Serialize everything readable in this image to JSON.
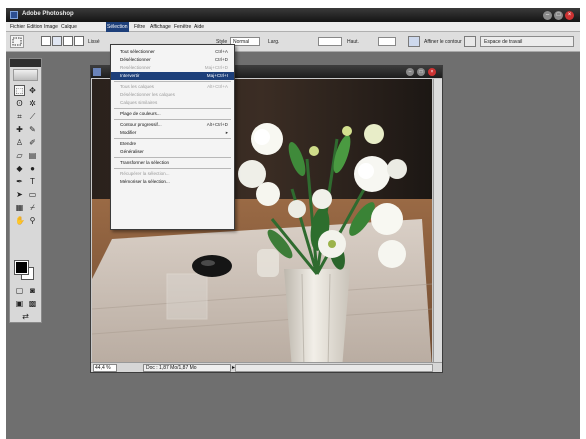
{
  "app": {
    "title": "Adobe Photoshop"
  },
  "menubar": {
    "items": [
      "Fichier",
      "Edition",
      "Image",
      "Calque",
      "Sélection",
      "Filtre",
      "Affichage",
      "Fenêtre",
      "Aide"
    ],
    "active": "Sélection"
  },
  "options": {
    "antialias_label": "Lissé",
    "style_label": "Style",
    "style_value": "Normal",
    "width_label": "Larg.",
    "height_label": "Haut.",
    "refine_label": "Affiner le contour",
    "workspace_label": "Espace de travail"
  },
  "document": {
    "zoom": "44,4 %",
    "status": "Doc : 1,87 Mo/1,87 Mo"
  },
  "selection_menu": {
    "items": [
      {
        "label": "Tout sélectionner",
        "shortcut": "Ctrl+A",
        "state": "normal"
      },
      {
        "label": "Désélectionner",
        "shortcut": "Ctrl+D",
        "state": "normal"
      },
      {
        "label": "Resélectionner",
        "shortcut": "Maj+Ctrl+D",
        "state": "disabled"
      },
      {
        "label": "Intervertir",
        "shortcut": "Maj+Ctrl+I",
        "state": "highlighted"
      },
      {
        "separator": true
      },
      {
        "label": "Tous les calques",
        "shortcut": "Alt+Ctrl+A",
        "state": "disabled"
      },
      {
        "label": "Désélectionner les calques",
        "shortcut": "",
        "state": "disabled"
      },
      {
        "label": "Calques similaires",
        "shortcut": "",
        "state": "disabled"
      },
      {
        "separator": true
      },
      {
        "label": "Plage de couleurs...",
        "shortcut": "",
        "state": "normal"
      },
      {
        "separator": true
      },
      {
        "label": "Contour progressif...",
        "shortcut": "Alt+Ctrl+D",
        "state": "normal"
      },
      {
        "label": "Modifier",
        "shortcut": "▸",
        "state": "normal"
      },
      {
        "separator": true
      },
      {
        "label": "Etendre",
        "shortcut": "",
        "state": "normal"
      },
      {
        "label": "Généraliser",
        "shortcut": "",
        "state": "normal"
      },
      {
        "separator": true
      },
      {
        "label": "Transformer la sélection",
        "shortcut": "",
        "state": "normal"
      },
      {
        "separator": true
      },
      {
        "label": "Récupérer la sélection...",
        "shortcut": "",
        "state": "disabled"
      },
      {
        "label": "Mémoriser la sélection...",
        "shortcut": "",
        "state": "normal"
      }
    ]
  },
  "colors": {
    "menu_highlight": "#1d3f7a",
    "workspace": "#6f6f6f",
    "foreground": "#000000",
    "background": "#ffffff"
  }
}
